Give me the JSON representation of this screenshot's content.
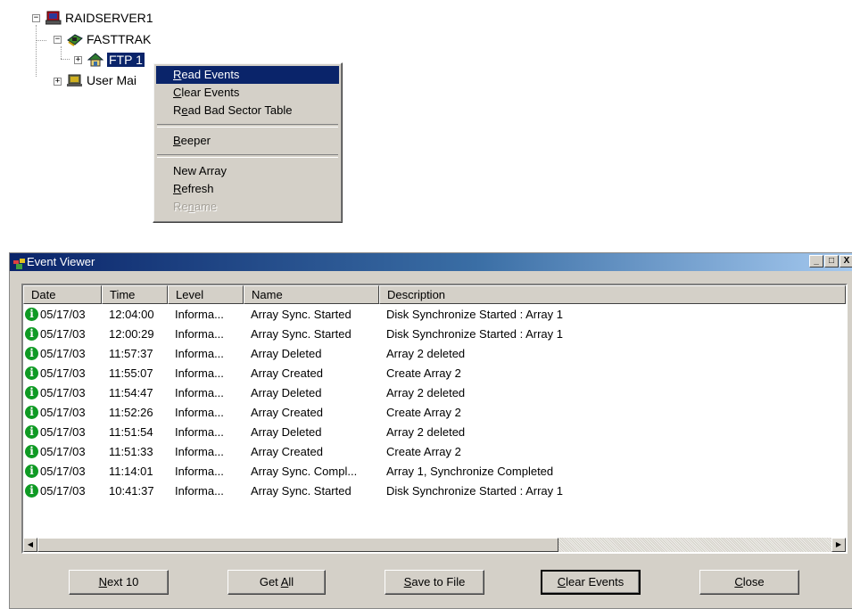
{
  "tree": {
    "root": "RAIDSERVER1",
    "controller": "FASTTRAK",
    "device": "FTP 1",
    "user_mgmt": "User Mai"
  },
  "context_menu": {
    "items": [
      {
        "pre": "",
        "key": "R",
        "post": "ead Events"
      },
      {
        "pre": "",
        "key": "C",
        "post": "lear Events"
      },
      {
        "pre": "R",
        "key": "e",
        "post": "ad Bad Sector Table"
      },
      {
        "pre": "",
        "key": "B",
        "post": "eeper"
      },
      {
        "pre": "New Array",
        "key": "",
        "post": ""
      },
      {
        "pre": "",
        "key": "R",
        "post": "efresh"
      },
      {
        "pre": "Re",
        "key": "n",
        "post": "ame"
      }
    ]
  },
  "window": {
    "title": "Event Viewer",
    "controls": {
      "minimize": "_",
      "maximize": "□",
      "close": "X"
    }
  },
  "events": {
    "columns": [
      "Date",
      "Time",
      "Level",
      "Name",
      "Description"
    ],
    "rows": [
      {
        "date": "05/17/03",
        "time": "12:04:00",
        "level": "Informa...",
        "name": "Array Sync. Started",
        "desc": "Disk Synchronize Started : Array 1"
      },
      {
        "date": "05/17/03",
        "time": "12:00:29",
        "level": "Informa...",
        "name": "Array Sync. Started",
        "desc": "Disk Synchronize Started : Array 1"
      },
      {
        "date": "05/17/03",
        "time": "11:57:37",
        "level": "Informa...",
        "name": "Array Deleted",
        "desc": "Array 2 deleted"
      },
      {
        "date": "05/17/03",
        "time": "11:55:07",
        "level": "Informa...",
        "name": "Array Created",
        "desc": "Create Array 2"
      },
      {
        "date": "05/17/03",
        "time": "11:54:47",
        "level": "Informa...",
        "name": "Array Deleted",
        "desc": "Array 2 deleted"
      },
      {
        "date": "05/17/03",
        "time": "11:52:26",
        "level": "Informa...",
        "name": "Array Created",
        "desc": "Create Array 2"
      },
      {
        "date": "05/17/03",
        "time": "11:51:54",
        "level": "Informa...",
        "name": "Array Deleted",
        "desc": "Array 2 deleted"
      },
      {
        "date": "05/17/03",
        "time": "11:51:33",
        "level": "Informa...",
        "name": "Array Created",
        "desc": "Create Array 2"
      },
      {
        "date": "05/17/03",
        "time": "11:14:01",
        "level": "Informa...",
        "name": "Array Sync. Compl...",
        "desc": "Array 1, Synchronize Completed"
      },
      {
        "date": "05/17/03",
        "time": "10:41:37",
        "level": "Informa...",
        "name": "Array Sync. Started",
        "desc": "Disk Synchronize Started : Array 1"
      }
    ]
  },
  "buttons": [
    {
      "pre": "",
      "key": "N",
      "post": "ext 10"
    },
    {
      "pre": "Get ",
      "key": "A",
      "post": "ll"
    },
    {
      "pre": "",
      "key": "S",
      "post": "ave to File"
    },
    {
      "pre": "",
      "key": "C",
      "post": "lear Events"
    },
    {
      "pre": "",
      "key": "C",
      "post": "lose"
    }
  ],
  "icons": {
    "info": "i",
    "scroll_left": "◀",
    "scroll_right": "▶",
    "expand": "+",
    "collapse": "−"
  },
  "colors": {
    "selection": "#0a246a",
    "info_green": "#0f9a24"
  }
}
